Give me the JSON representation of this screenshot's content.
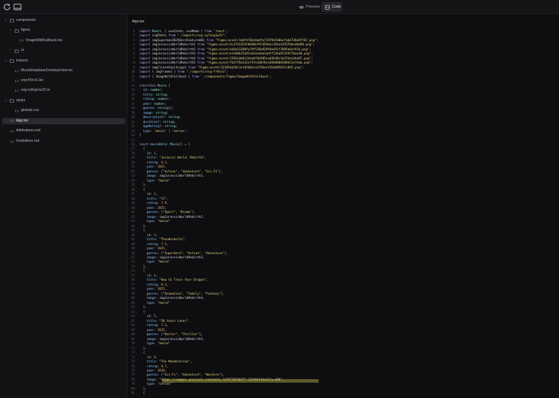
{
  "toolbar": {
    "refresh_icon": "refresh-icon",
    "panel_icon": "sidebar-panel-icon",
    "preview_label": "Preview",
    "code_label": "Code"
  },
  "explorer": {
    "items": [
      {
        "name": "components",
        "type": "folder",
        "depth": 0,
        "expanded": true
      },
      {
        "name": "figma",
        "type": "folder",
        "depth": 1,
        "expanded": true
      },
      {
        "name": "ImageWithFallback.tsx",
        "type": "file",
        "depth": 2
      },
      {
        "name": "ui",
        "type": "folder",
        "depth": 1,
        "expanded": false
      },
      {
        "name": "imports",
        "type": "folder",
        "depth": 0,
        "expanded": true
      },
      {
        "name": "MovieDatabaseDesktopView.tsx",
        "type": "file",
        "depth": 1
      },
      {
        "name": "svg-fr9cx1.tsx",
        "type": "file",
        "depth": 1
      },
      {
        "name": "svg-vyltop1w31.ts",
        "type": "file",
        "depth": 1
      },
      {
        "name": "styles",
        "type": "folder",
        "depth": 0,
        "expanded": true
      },
      {
        "name": "globals.css",
        "type": "file",
        "depth": 1
      },
      {
        "name": "App.tsx",
        "type": "file",
        "depth": 0,
        "selected": true
      },
      {
        "name": "Attributions.md",
        "type": "file",
        "depth": 0
      },
      {
        "name": "Guidelines.md",
        "type": "file",
        "depth": 0
      }
    ]
  },
  "editor": {
    "active_file": "App.tsx",
    "highlight_line": 78,
    "fold_lines": [
      13,
      26,
      27,
      36,
      45,
      54,
      63,
      72,
      81
    ],
    "lines": [
      "import React, { useState, useMemo } from 'react';",
      "import svgPaths from \"./imports/svg-vyltop1w31\";",
      "import imgSupermen2025HeroFeature001 from \"figma:asset/14df4760cbbdfa71979d7d0bcfab4728a9f767.png\";",
      "import imgJurassicWorldRebirth1 from \"figma:asset/4c2742254f0b98ef97d594ac391ed155f0dcdb698.png\";",
      "import imgJurassicWorldRebirth2 from \"figma:asset/e64a53208fa79f530e928f0a451f3995a6ef424.png\";",
      "import imgJurassicWorldRebirth3 from \"figma:asset/efe68b22a92c6e1e4ab1adff22bd9731977bae48.png\";",
      "import imgJurassicWorldRebirth4 from \"figma:asset/1592a3b8c1dee6f4d285cad3b38c1b374ee2be87.png\";",
      "import imgJurassicWorldRebirth5 from \"figma:asset/fb1f79a112ef3fe3dbf8cc69b680b580421ef4ab.png\";",
      "import imgClientVaultLogo1 from \"figma:asset/32185da59c1efd5db2ca3f5beefd5d4956f1c692.png\";",
      "import { imgFrame3 } from \"./imports/svg-fr9cx1\";",
      "import { ImageWithFallback } from './components/figma/ImageWithFallback';",
      "",
      "interface Movie {",
      "  id: number;",
      "  title: string;",
      "  rating: number;",
      "  year: number;",
      "  genres: string[];",
      "  image: string;",
      "  description?: string;",
      "  duration?: string;",
      "  ageRating?: string;",
      "  type: 'movie' | 'series';",
      "}",
      "",
      "const movieData: Movie[] = [",
      "  {",
      "    id: 1,",
      "    title: \"Jurassic World: Rebirth\",",
      "    rating: 6.2,",
      "    year: 2025,",
      "    genres: [\"Action\", \"Adventure\", \"Sci-Fi\"],",
      "    image: imgJurassicWorldRebirth1,",
      "    type: \"movie\"",
      "  },",
      "  {",
      "    id: 2,",
      "    title: \"F1\",",
      "    rating: 7.9,",
      "    year: 2025,",
      "    genres: [\"Sport\", \"Drama\"],",
      "    image: imgJurassicWorldRebirth2,",
      "    type: \"movie\"",
      "  },",
      "  {",
      "    id: 3,",
      "    title: \"Thunderbolts\",",
      "    rating: 7.5,",
      "    year: 2025,",
      "    genres: [\"Superhero\", \"Action\", \"Adventure\"],",
      "    image: imgJurassicWorldRebirth3,",
      "    type: \"movie\"",
      "  },",
      "  {",
      "    id: 4,",
      "    title: \"How to Train Your Dragon\",",
      "    rating: 8.1,",
      "    year: 2025,",
      "    genres: [\"Animation\", \"Family\", \"Fantasy\"],",
      "    image: imgJurassicWorldRebirth4,",
      "    type: \"movie\"",
      "  },",
      "  {",
      "    id: 5,",
      "    title: \"28 Years Later\",",
      "    rating: 7.1,",
      "    year: 2025,",
      "    genres: [\"Horror\", \"Thriller\"],",
      "    image: imgJurassicWorldRebirth5,",
      "    type: \"movie\"",
      "  },",
      "  {",
      "    id: 6,",
      "    title: \"The Mandalorian\",",
      "    rating: 8.7,",
      "    year: 2019,",
      "    genres: [\"Sci-Fi\", \"Adventure\", \"Western\"],",
      "    image: \"https://images.unsplash.com/photo-1478720568477-152d9b164e26?w=400\",",
      "    type: \"series\"",
      "  },",
      "  {"
    ]
  }
}
